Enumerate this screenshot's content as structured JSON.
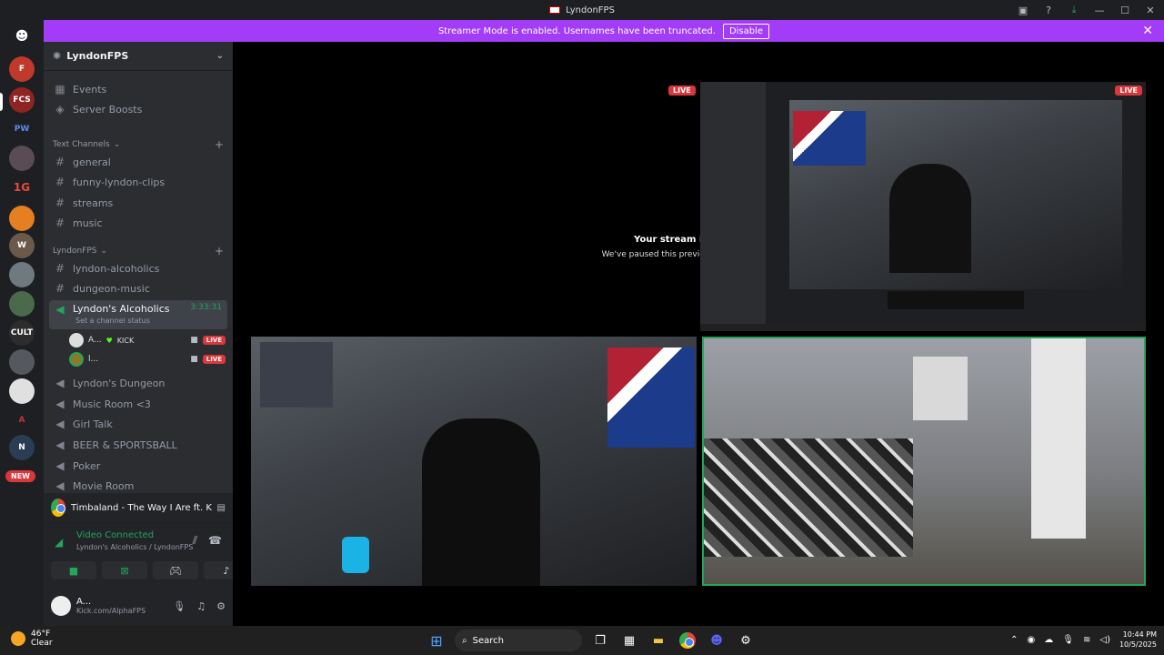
{
  "window": {
    "title": "LyndonFPS"
  },
  "banner": {
    "message": "Streamer Mode is enabled. Usernames have been truncated.",
    "disable_label": "Disable"
  },
  "rail": {
    "new_badge": "NEW"
  },
  "server": {
    "name": "LyndonFPS",
    "links": [
      {
        "label": "Events",
        "icon": "calendar-icon"
      },
      {
        "label": "Server Boosts",
        "icon": "boost-icon"
      }
    ],
    "categories": {
      "text": "Text Channels",
      "lyndon": "LyndonFPS"
    },
    "text_channels": [
      "general",
      "funny-lyndon-clips",
      "streams",
      "music"
    ],
    "lyndon_channels": [
      "lyndon-alcoholics",
      "dungeon-music"
    ],
    "active_voice": {
      "name": "Lyndon's Alcoholics",
      "timer": "3:33:31",
      "status": "Set a channel status"
    },
    "voice_users": [
      {
        "name": "A...",
        "badge": "KICK",
        "live": "LIVE"
      },
      {
        "name": "l...",
        "live": "LIVE"
      }
    ],
    "voice_channels": [
      "Lyndon's Dungeon",
      "Music Room <3",
      "Girl Talk",
      "BEER & SPORTSBALL",
      "Poker",
      "Movie Room"
    ]
  },
  "now_playing": {
    "text": "Timbaland - The Way I Are ft. Keri Hil..."
  },
  "voice": {
    "status": "Video Connected",
    "location": "Lyndon's Alcoholics / LyndonFPS"
  },
  "user": {
    "name": "A...",
    "status": "Kick.com/AlphaFPS"
  },
  "stage": {
    "paused_title": "Your stream is still running!",
    "paused_sub": "We've paused this preview to save your resources.",
    "live": "LIVE"
  },
  "taskbar": {
    "temp": "46°F",
    "cond": "Clear",
    "search": "Search",
    "time": "10:44 PM",
    "date": "10/5/2025"
  },
  "colors": {
    "accent": "#a23cf7",
    "live": "#da373c",
    "connected": "#23a55a"
  }
}
